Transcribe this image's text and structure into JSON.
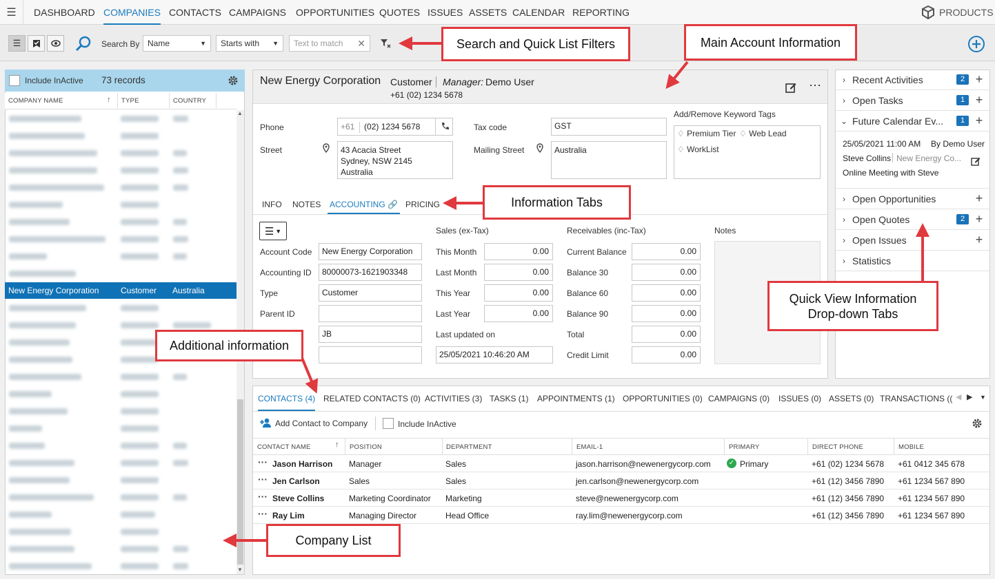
{
  "nav": {
    "items": [
      "DASHBOARD",
      "COMPANIES",
      "CONTACTS",
      "CAMPAIGNS",
      "OPPORTUNITIES",
      "QUOTES",
      "ISSUES",
      "ASSETS",
      "CALENDAR",
      "REPORTING"
    ],
    "active": "COMPANIES",
    "products_label": "PRODUCTS"
  },
  "search": {
    "search_by_label": "Search By",
    "field_value": "Name",
    "match_value": "Starts with",
    "text_placeholder": "Text to match"
  },
  "callouts": {
    "search_filters": "Search and Quick List Filters",
    "main_account": "Main Account Information",
    "info_tabs": "Information Tabs",
    "quick_view": "Quick View Information Drop-down Tabs",
    "additional": "Additional information",
    "company_list": "Company List"
  },
  "company_list": {
    "include_inactive_label": "Include InActive",
    "record_count": "73 records",
    "columns": [
      "COMPANY NAME",
      "TYPE",
      "COUNTRY"
    ],
    "selected_row": {
      "name": "New Energy Corporation",
      "type": "Customer",
      "country": "Australia"
    }
  },
  "account": {
    "name": "New Energy Corporation",
    "type": "Customer",
    "manager_label": "Manager:",
    "manager": "Demo User",
    "phone_header": "+61 (02) 1234 5678",
    "phone_label": "Phone",
    "phone_code": "+61",
    "phone_number": "(02) 1234 5678",
    "street_label": "Street",
    "street_lines": [
      "43 Acacia Street",
      "Sydney, NSW 2145",
      "Australia"
    ],
    "tax_label": "Tax code",
    "tax_value": "GST",
    "mailing_label": "Mailing Street",
    "mailing_value": "Australia",
    "tags_label": "Add/Remove Keyword Tags",
    "tags": [
      "Premium Tier",
      "Web Lead",
      "WorkList"
    ]
  },
  "info_tabs": [
    "INFO",
    "NOTES",
    "ACCOUNTING",
    "PRICING"
  ],
  "accounting": {
    "fields": [
      {
        "label": "Account Code",
        "value": "New Energy Corporation"
      },
      {
        "label": "Accounting ID",
        "value": "80000073-1621903348"
      },
      {
        "label": "Type",
        "value": "Customer"
      },
      {
        "label": "Parent ID",
        "value": ""
      },
      {
        "label": "",
        "value": "JB"
      },
      {
        "label": "",
        "value": ""
      }
    ],
    "sales_header": "Sales (ex-Tax)",
    "sales": [
      {
        "label": "This Month",
        "value": "0.00"
      },
      {
        "label": "Last Month",
        "value": "0.00"
      },
      {
        "label": "This Year",
        "value": "0.00"
      },
      {
        "label": "Last Year",
        "value": "0.00"
      }
    ],
    "last_updated_label": "Last updated on",
    "last_updated_value": "25/05/2021 10:46:20 AM",
    "receivables_header": "Receivables (inc-Tax)",
    "receivables": [
      {
        "label": "Current Balance",
        "value": "0.00"
      },
      {
        "label": "Balance 30",
        "value": "0.00"
      },
      {
        "label": "Balance 60",
        "value": "0.00"
      },
      {
        "label": "Balance 90",
        "value": "0.00"
      },
      {
        "label": "Total",
        "value": "0.00"
      },
      {
        "label": "Credit Limit",
        "value": "0.00"
      }
    ],
    "notes_label": "Notes"
  },
  "quick_view": {
    "rows": [
      {
        "label": "Recent Activities",
        "badge": "2"
      },
      {
        "label": "Open Tasks",
        "badge": "1"
      },
      {
        "label": "Future Calendar Ev...",
        "badge": "1"
      },
      {
        "label": "Open Opportunities",
        "badge": ""
      },
      {
        "label": "Open Quotes",
        "badge": "2"
      },
      {
        "label": "Open Issues",
        "badge": ""
      },
      {
        "label": "Statistics",
        "badge": ""
      }
    ],
    "event": {
      "datetime": "25/05/2021 11:00 AM",
      "by": "By Demo User",
      "person": "Steve Collins",
      "company": "New Energy Co...",
      "subject": "Online Meeting with Steve"
    }
  },
  "bottom_tabs": [
    "CONTACTS (4)",
    "RELATED CONTACTS (0)",
    "ACTIVITIES (3)",
    "TASKS (1)",
    "APPOINTMENTS (1)",
    "OPPORTUNITIES (0)",
    "CAMPAIGNS (0)",
    "ISSUES (0)",
    "ASSETS (0)",
    "TRANSACTIONS (("
  ],
  "contacts": {
    "add_label": "Add Contact to Company",
    "include_inactive_label": "Include InActive",
    "columns": [
      "CONTACT NAME",
      "POSITION",
      "DEPARTMENT",
      "EMAIL-1",
      "PRIMARY",
      "DIRECT PHONE",
      "MOBILE"
    ],
    "rows": [
      {
        "name": "Jason Harrison",
        "position": "Manager",
        "department": "Sales",
        "email": "jason.harrison@newenergycorp.com",
        "primary": "Primary",
        "phone": "+61 (02) 1234 5678",
        "mobile": "+61 0412 345 678"
      },
      {
        "name": "Jen Carlson",
        "position": "Sales",
        "department": "Sales",
        "email": "jen.carlson@newenergycorp.com",
        "primary": "",
        "phone": "+61 (12) 3456 7890",
        "mobile": "+61 1234 567 890"
      },
      {
        "name": "Steve Collins",
        "position": "Marketing Coordinator",
        "department": "Marketing",
        "email": "steve@newenergycorp.com",
        "primary": "",
        "phone": "+61 (12) 3456 7890",
        "mobile": "+61 1234 567 890"
      },
      {
        "name": "Ray Lim",
        "position": "Managing Director",
        "department": "Head Office",
        "email": "ray.lim@newenergycorp.com",
        "primary": "",
        "phone": "+61 (12) 3456 7890",
        "mobile": "+61 1234 567 890"
      }
    ]
  },
  "colors": {
    "accent": "#1a7bbf",
    "selected_row": "#1072b6",
    "callout_border": "#e0393e",
    "list_header": "#a9d6ec"
  }
}
